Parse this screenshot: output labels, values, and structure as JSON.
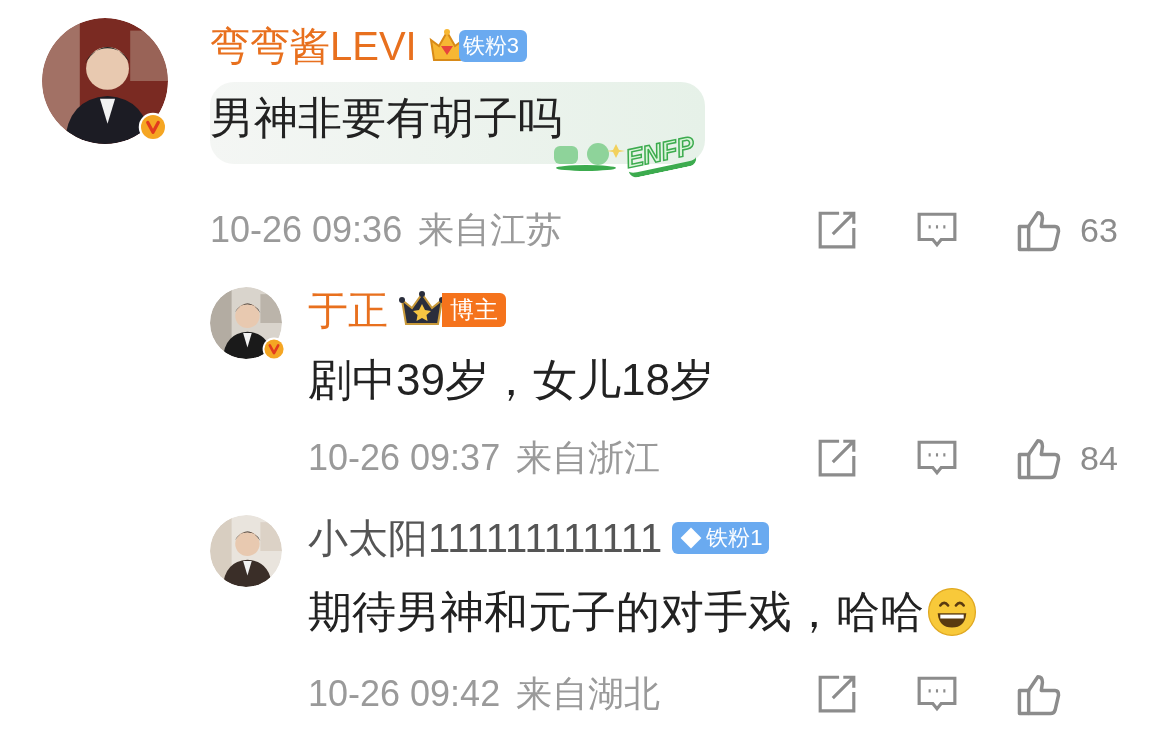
{
  "comments": [
    {
      "name": "弯弯酱LEVI",
      "vip": true,
      "verified": true,
      "reply": false,
      "badge": {
        "kind": "fan",
        "label": "铁粉3"
      },
      "text": "男神非要有胡子吗",
      "trailing_emoji": false,
      "bubble": {
        "tag": "ENFP"
      },
      "time": "10-26 09:36",
      "location": "来自江苏",
      "likes": "63"
    },
    {
      "name": "于正",
      "vip": true,
      "verified": true,
      "reply": true,
      "badge": {
        "kind": "blogger",
        "label": "博主"
      },
      "text": "剧中39岁，女儿18岁",
      "trailing_emoji": false,
      "time": "10-26 09:37",
      "location": "来自浙江",
      "likes": "84"
    },
    {
      "name": "小太阳111111111111",
      "vip": false,
      "verified": false,
      "reply": true,
      "badge": {
        "kind": "fan",
        "label": "铁粉1"
      },
      "text": "期待男神和元子的对手戏，哈哈",
      "trailing_emoji": true,
      "time": "10-26 09:42",
      "location": "来自湖北"
    }
  ]
}
